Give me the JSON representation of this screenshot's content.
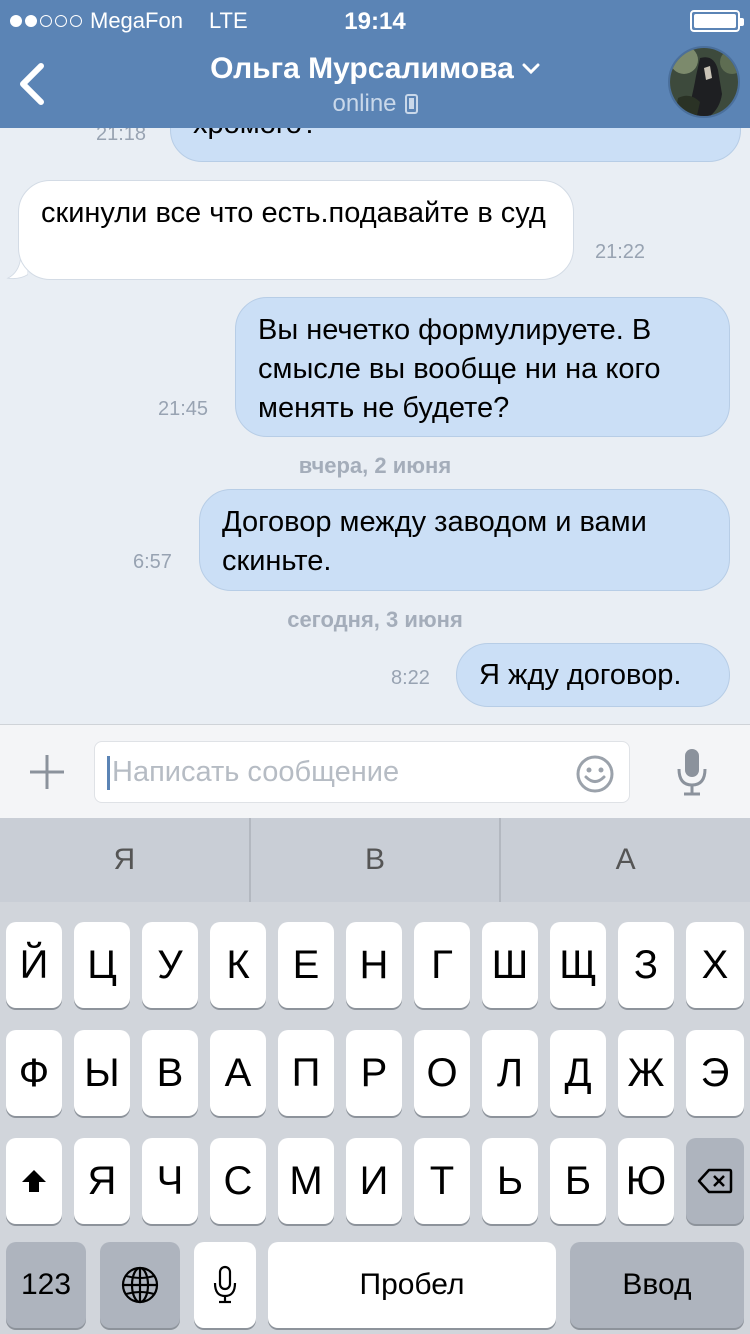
{
  "status_bar": {
    "signal_dots_filled": 2,
    "signal_dots_total": 5,
    "carrier": "MegaFon",
    "network": "LTE",
    "time": "19:14"
  },
  "header": {
    "contact_name": "Ольга Мурсалимова",
    "status": "online"
  },
  "messages": [
    {
      "direction": "out",
      "text": "хромого?",
      "time": "21:18"
    },
    {
      "direction": "in",
      "text": "скинули все что есть.подавайте в суд",
      "time": "21:22"
    },
    {
      "direction": "out",
      "text": "Вы нечетко формулируете. В смысле вы вообще ни на кого менять не будете?",
      "time": "21:45"
    },
    {
      "direction": "separator",
      "text": "вчера, 2 июня"
    },
    {
      "direction": "out",
      "text": "Договор между заводом и вами скиньте.",
      "time": "6:57"
    },
    {
      "direction": "separator",
      "text": "сегодня, 3 июня"
    },
    {
      "direction": "out",
      "text": "Я жду договор.",
      "time": "8:22"
    }
  ],
  "input": {
    "placeholder": "Написать сообщение"
  },
  "keyboard": {
    "suggestions": [
      "Я",
      "В",
      "А"
    ],
    "row1": [
      "Й",
      "Ц",
      "У",
      "К",
      "Е",
      "Н",
      "Г",
      "Ш",
      "Щ",
      "З",
      "Х"
    ],
    "row2": [
      "Ф",
      "Ы",
      "В",
      "А",
      "П",
      "Р",
      "О",
      "Л",
      "Д",
      "Ж",
      "Э"
    ],
    "row3": [
      "Я",
      "Ч",
      "С",
      "М",
      "И",
      "Т",
      "Ь",
      "Б",
      "Ю"
    ],
    "numbers_label": "123",
    "space_label": "Пробел",
    "return_label": "Ввод"
  },
  "colors": {
    "header": "#5b84b5",
    "outgoing_bubble": "#cbdff6",
    "incoming_bubble": "#ffffff",
    "chat_background": "#e9eef4"
  }
}
